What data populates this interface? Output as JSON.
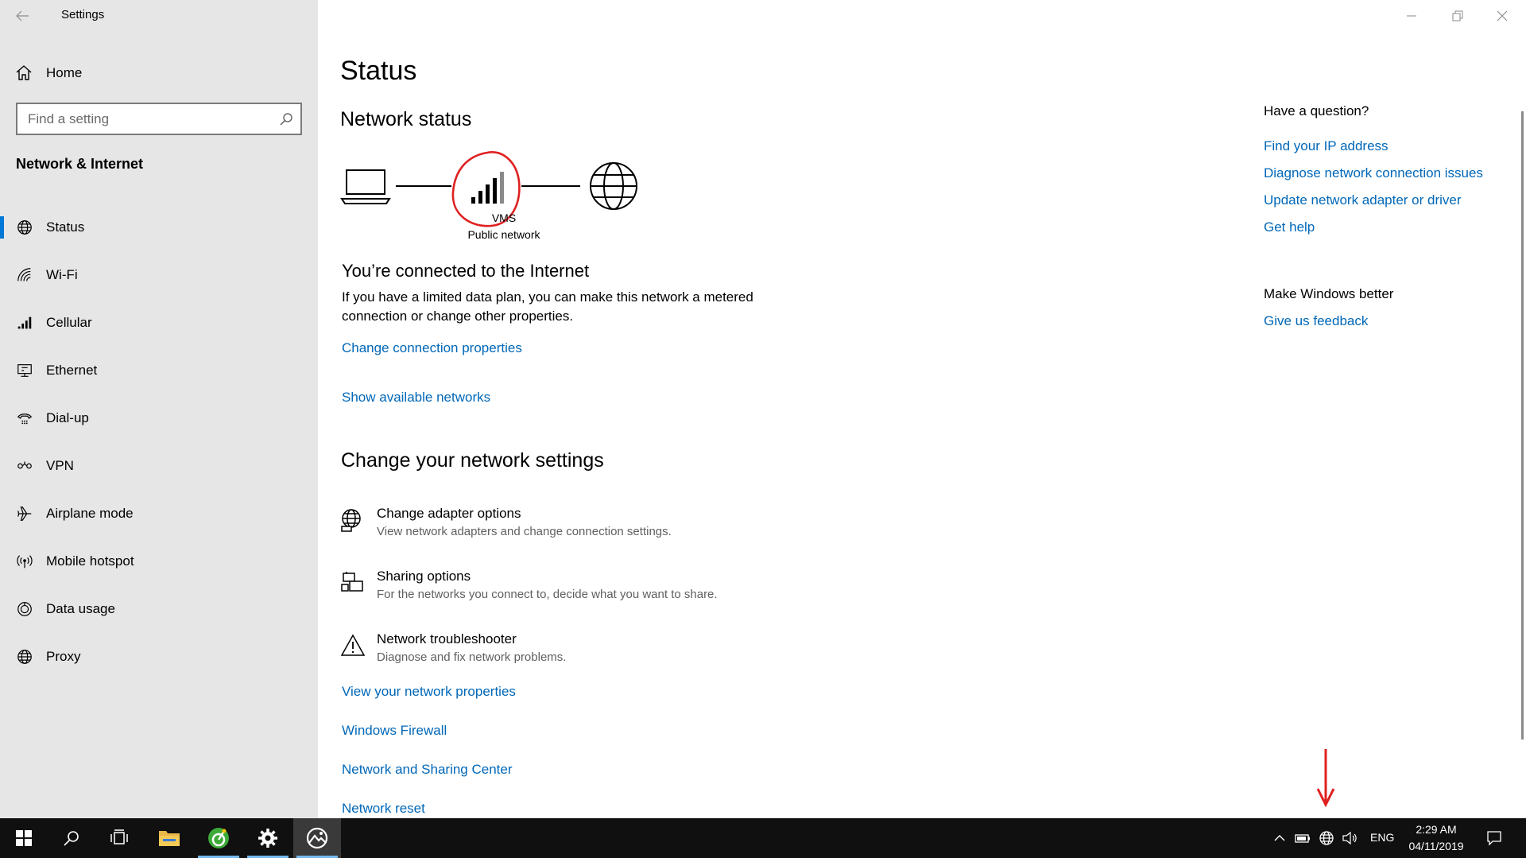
{
  "window": {
    "title": "Settings",
    "minimize_icon": "minimize-icon",
    "maximize_icon": "restore-icon",
    "close_icon": "close-icon"
  },
  "sidebar": {
    "home_label": "Home",
    "search_placeholder": "Find a setting",
    "section_title": "Network & Internet",
    "items": [
      {
        "label": "Status",
        "icon": "globe-icon",
        "active": true
      },
      {
        "label": "Wi-Fi",
        "icon": "wifi-icon"
      },
      {
        "label": "Cellular",
        "icon": "cellular-icon"
      },
      {
        "label": "Ethernet",
        "icon": "ethernet-icon"
      },
      {
        "label": "Dial-up",
        "icon": "dialup-icon"
      },
      {
        "label": "VPN",
        "icon": "vpn-icon"
      },
      {
        "label": "Airplane mode",
        "icon": "airplane-icon"
      },
      {
        "label": "Mobile hotspot",
        "icon": "hotspot-icon"
      },
      {
        "label": "Data usage",
        "icon": "data-usage-icon"
      },
      {
        "label": "Proxy",
        "icon": "globe-icon"
      }
    ]
  },
  "main": {
    "page_title": "Status",
    "network_status_heading": "Network status",
    "network_name": "VMS",
    "network_type": "Public network",
    "connected_heading": "You’re connected to the Internet",
    "connected_desc": "If you have a limited data plan, you can make this network a metered connection or change other properties.",
    "change_connection_link": "Change connection properties",
    "show_networks_link": "Show available networks",
    "change_settings_heading": "Change your network settings",
    "options": [
      {
        "title": "Change adapter options",
        "subtitle": "View network adapters and change connection settings.",
        "icon": "adapter-icon"
      },
      {
        "title": "Sharing options",
        "subtitle": "For the networks you connect to, decide what you want to share.",
        "icon": "sharing-icon"
      },
      {
        "title": "Network troubleshooter",
        "subtitle": "Diagnose and fix network problems.",
        "icon": "warning-icon"
      }
    ],
    "links": [
      "View your network properties",
      "Windows Firewall",
      "Network and Sharing Center",
      "Network reset"
    ]
  },
  "help": {
    "question_heading": "Have a question?",
    "question_links": [
      "Find your IP address",
      "Diagnose network connection issues",
      "Update network adapter or driver",
      "Get help"
    ],
    "better_heading": "Make Windows better",
    "feedback_link": "Give us feedback"
  },
  "taskbar": {
    "apps": [
      "start-icon",
      "search-icon",
      "task-view-icon",
      "file-explorer-icon",
      "app-green-icon",
      "settings-gear-icon",
      "photos-app-icon"
    ],
    "language": "ENG",
    "time": "2:29 AM",
    "date": "04/11/2019"
  },
  "colors": {
    "accent": "#0078d7",
    "link": "#0067b8",
    "sidebar_bg": "#e6e6e6",
    "taskbar_bg": "#101010",
    "annotation": "#e02020"
  }
}
